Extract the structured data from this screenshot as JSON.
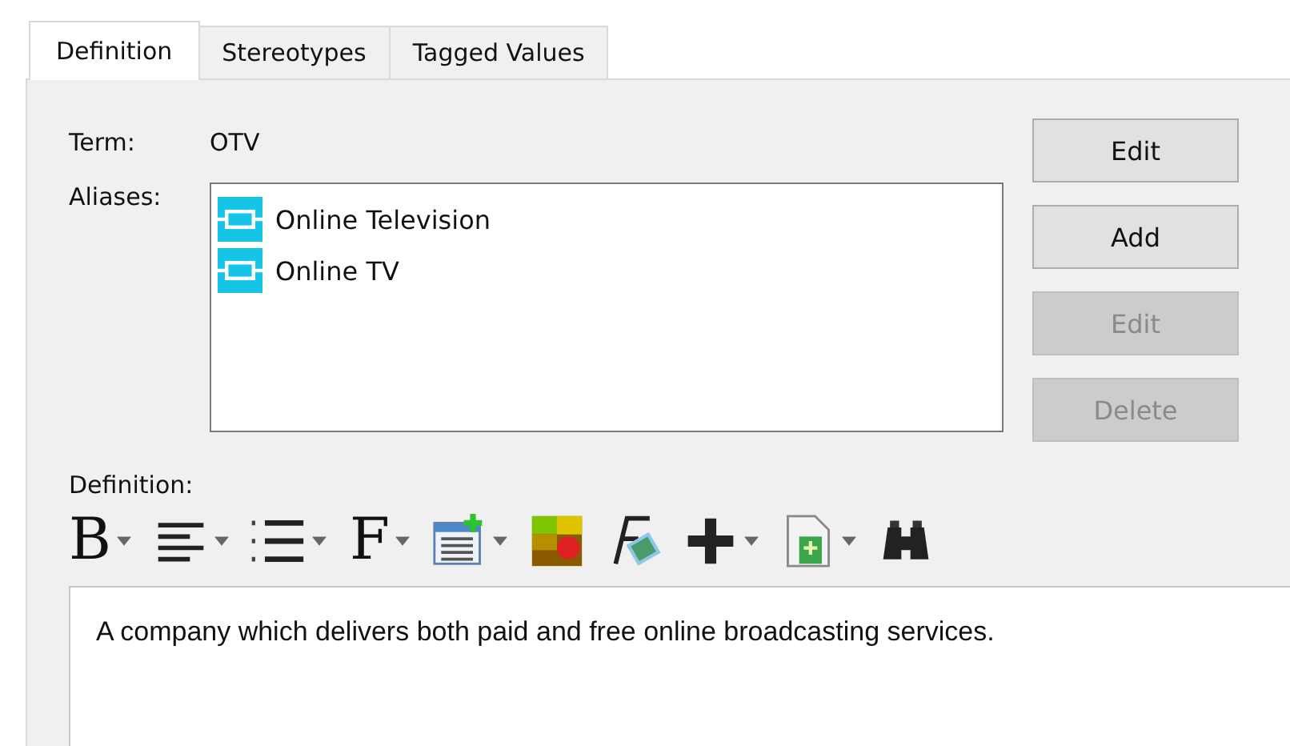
{
  "tabs": [
    {
      "label": "Definition",
      "selected": true
    },
    {
      "label": "Stereotypes",
      "selected": false
    },
    {
      "label": "Tagged Values",
      "selected": false
    }
  ],
  "term": {
    "label": "Term:",
    "value": "OTV"
  },
  "aliases": {
    "label": "Aliases:",
    "items": [
      "Online Television",
      "Online TV"
    ]
  },
  "buttons": [
    {
      "label": "Edit",
      "disabled": false
    },
    {
      "label": "Add",
      "disabled": false
    },
    {
      "label": "Edit",
      "disabled": true
    },
    {
      "label": "Delete",
      "disabled": true
    }
  ],
  "definition": {
    "label": "Definition:",
    "toolbar": [
      {
        "kind": "glyph",
        "text": "B",
        "dropdown": true
      },
      {
        "kind": "align",
        "dropdown": true
      },
      {
        "kind": "list",
        "dropdown": true
      },
      {
        "kind": "glyph",
        "text": "F",
        "dropdown": true
      },
      {
        "kind": "table",
        "dropdown": true
      },
      {
        "kind": "palette",
        "dropdown": false
      },
      {
        "kind": "formula",
        "dropdown": false
      },
      {
        "kind": "plus",
        "dropdown": true
      },
      {
        "kind": "document",
        "dropdown": true
      },
      {
        "kind": "binoculars",
        "dropdown": false
      }
    ],
    "text": "A company which delivers both paid and free online broadcasting services."
  }
}
